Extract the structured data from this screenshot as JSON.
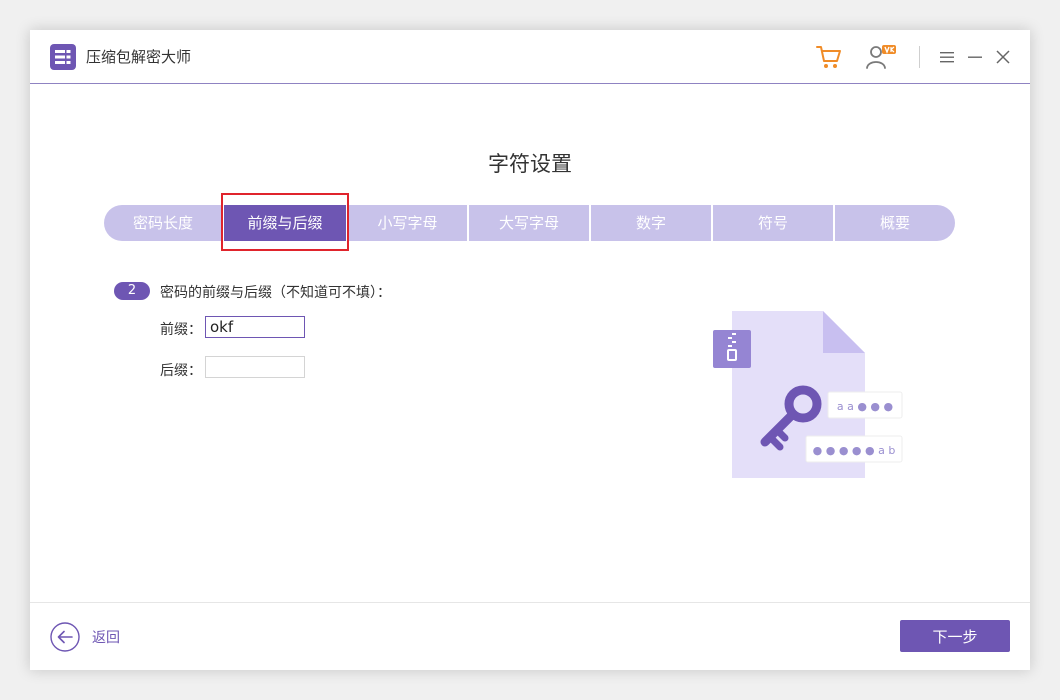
{
  "app": {
    "title": "压缩包解密大师",
    "logo_icon": "archive-list-icon",
    "brand_color": "#6e56b3",
    "accent_orange": "#f08c28"
  },
  "titlebar": {
    "icons": [
      "cart-icon",
      "user-vip-icon",
      "menu-icon",
      "minimize-icon",
      "close-icon"
    ]
  },
  "section": {
    "title": "字符设置"
  },
  "tabs": [
    {
      "label": "密码长度",
      "active": false
    },
    {
      "label": "前缀与后缀",
      "active": true
    },
    {
      "label": "小写字母",
      "active": false
    },
    {
      "label": "大写字母",
      "active": false
    },
    {
      "label": "数字",
      "active": false
    },
    {
      "label": "符号",
      "active": false
    },
    {
      "label": "概要",
      "active": false
    }
  ],
  "form": {
    "step_number": "2",
    "step_text": "密码的前缀与后缀（不知道可不填）：",
    "prefix_label": "前缀：",
    "prefix_value": "okf",
    "suffix_label": "后缀：",
    "suffix_value": ""
  },
  "illustration": {
    "card1_text": "a a ● ● ●",
    "card2_text": "● ● ● ● ● a b"
  },
  "footer": {
    "back_label": "返回",
    "next_label": "下一步"
  }
}
